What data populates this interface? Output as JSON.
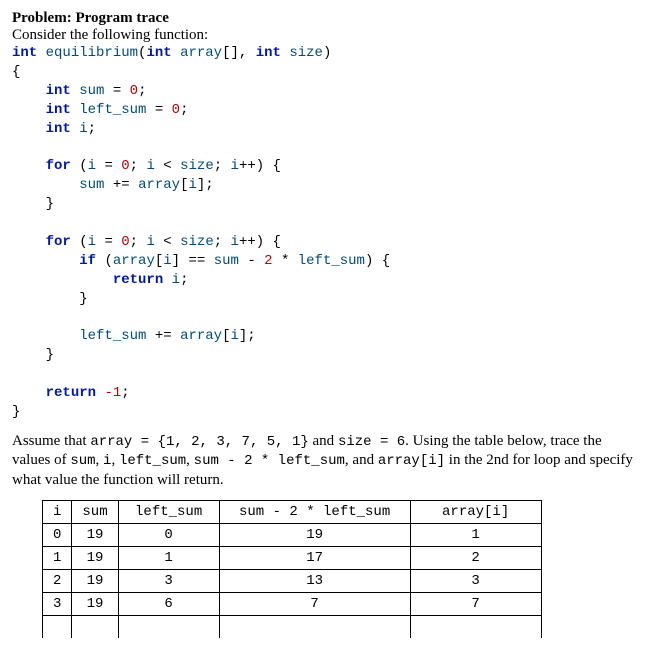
{
  "heading": {
    "title": "Problem: Program trace",
    "prompt": "Consider the following function:"
  },
  "code": {
    "kw_int": "int",
    "kw_for": "for",
    "kw_if": "if",
    "kw_return": "return",
    "fn": "equilibrium",
    "p_array": "array",
    "p_size": "size",
    "v_sum": "sum",
    "v_left_sum": "left_sum",
    "v_i": "i",
    "lit0": "0",
    "lit2": "2",
    "litm1": "-1"
  },
  "desc": {
    "t1": "Assume that ",
    "t2": "array = {1, 2, 3, 7, 5, 1}",
    "t3": " and ",
    "t4": "size = 6",
    "t5": ". Using the table below, trace the values of ",
    "t6": "sum",
    "t7": ", ",
    "t8": "i",
    "t9": ", ",
    "t10": "left_sum",
    "t11": ", ",
    "t12": "sum - 2 * left_sum",
    "t13": ", and ",
    "t14": "array[i]",
    "t15": " in the 2nd for loop and specify what value the function will return."
  },
  "table": {
    "headers": {
      "c1": "i",
      "c2": "sum",
      "c3": "left_sum",
      "c4": "sum - 2 * left_sum",
      "c5": "array[i]"
    },
    "rows": [
      {
        "i": "0",
        "sum": "19",
        "ls": "0",
        "expr": "19",
        "ai": "1"
      },
      {
        "i": "1",
        "sum": "19",
        "ls": "1",
        "expr": "17",
        "ai": "2"
      },
      {
        "i": "2",
        "sum": "19",
        "ls": "3",
        "expr": "13",
        "ai": "3"
      },
      {
        "i": "3",
        "sum": "19",
        "ls": "6",
        "expr": "7",
        "ai": "7"
      }
    ]
  },
  "chart_data": {
    "type": "table",
    "title": "Program trace of equilibrium function, 2nd for loop",
    "columns": [
      "i",
      "sum",
      "left_sum",
      "sum - 2 * left_sum",
      "array[i]"
    ],
    "rows": [
      [
        0,
        19,
        0,
        19,
        1
      ],
      [
        1,
        19,
        1,
        17,
        2
      ],
      [
        2,
        19,
        3,
        13,
        3
      ],
      [
        3,
        19,
        6,
        7,
        7
      ]
    ],
    "input": {
      "array": [
        1,
        2,
        3,
        7,
        5,
        1
      ],
      "size": 6
    }
  }
}
